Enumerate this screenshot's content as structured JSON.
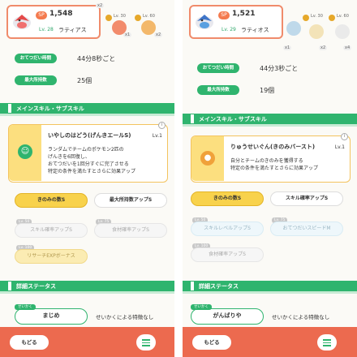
{
  "left": {
    "pokemon": {
      "number": "1,548",
      "sp": "SP",
      "level": "Lv. 28",
      "name": "ラティアス"
    },
    "fruits": [
      {
        "label": "Lv. 30",
        "count": "x1"
      },
      {
        "label": "Lv. 60",
        "count": "x2"
      }
    ],
    "extra_count": "x2",
    "help_interval_label": "おてつだい時間",
    "help_interval_value": "44分8秒ごと",
    "max_carry_label": "最大所持数",
    "max_carry_value": "25個",
    "section_skills": "メインスキル・サブスキル",
    "main_skill": {
      "name": "いやしのはどう(げんきエールS)",
      "level": "Lv.1",
      "description": "ランダムでチームのポケモン2匹の\nげんきを6回復し、\nおてつだいを1回分すぐに完了させる\n特定の条件を満たすとさらに効果アップ"
    },
    "sub_skills": [
      {
        "label": "きのみの数S",
        "tag": ""
      },
      {
        "label": "最大所持数アップS",
        "tag": ""
      },
      {
        "label": "スキル確率アップS",
        "tag": "Lv. 50"
      },
      {
        "label": "食材確率アップS",
        "tag": "Lv. 75"
      },
      {
        "label": "リサーチEXPボーナス",
        "tag": "Lv. 100"
      }
    ],
    "section_status": "詳細ステータス",
    "nature_tag": "せいかく",
    "nature": "まじめ",
    "nature_desc": "せいかくによる特徴なし",
    "back_label": "もどる"
  },
  "right": {
    "pokemon": {
      "number": "1,521",
      "sp": "SP",
      "level": "Lv. 29",
      "name": "ラティオス"
    },
    "fruits": [
      {
        "label": "Lv. 30",
        "count": "x2"
      },
      {
        "label": "Lv. 60",
        "count": "x4"
      }
    ],
    "extra_count": "x1",
    "help_interval_label": "おてつだい時間",
    "help_interval_value": "44分3秒ごと",
    "max_carry_label": "最大所持数",
    "max_carry_value": "19個",
    "section_skills": "メインスキル・サブスキル",
    "main_skill": {
      "name": "りゅうせいぐん(きのみバースト)",
      "level": "Lv.1",
      "description": "自分とチームのきのみを獲得する\n特定の条件を満たすとさらに効果アップ"
    },
    "sub_skills": [
      {
        "label": "きのみの数S",
        "tag": ""
      },
      {
        "label": "スキル確率アップS",
        "tag": ""
      },
      {
        "label": "スキルレベルアップS",
        "tag": "Lv. 50"
      },
      {
        "label": "おてつだいスピードM",
        "tag": "Lv. 75"
      },
      {
        "label": "食材確率アップS",
        "tag": "Lv. 100"
      }
    ],
    "section_status": "詳細ステータス",
    "nature_tag": "せいかく",
    "nature": "がんばりや",
    "nature_desc": "せいかくによる特徴なし",
    "back_label": "もどる"
  },
  "colors": {
    "accent_green": "#2fb46e",
    "accent_orange": "#ec6a4f",
    "skill_yellow": "#f8d24c"
  }
}
